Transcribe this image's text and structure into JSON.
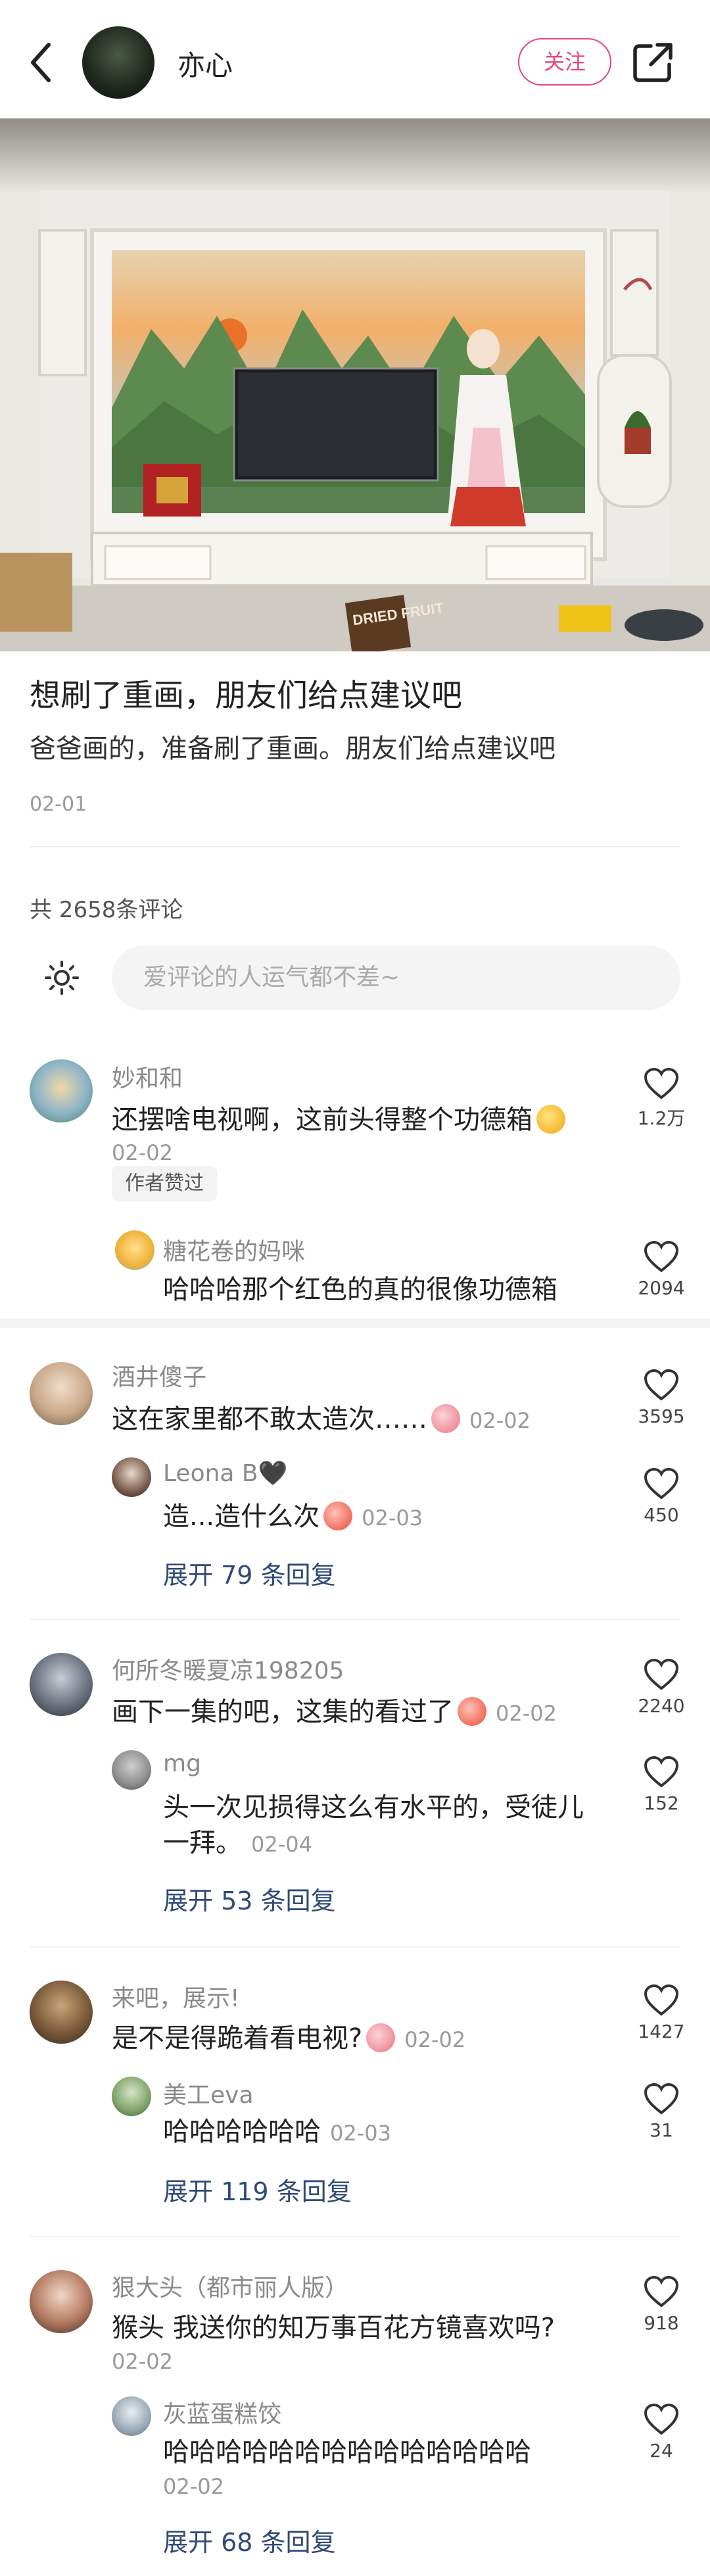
{
  "header": {
    "author_name": "亦心",
    "follow_label": "关注"
  },
  "post": {
    "title": "想刷了重画，朋友们给点建议吧",
    "description": "爸爸画的，准备刷了重画。朋友们给点建议吧",
    "date": "02-01",
    "image_text": "DRIED FRUIT"
  },
  "comments_header": {
    "count_text": "共 2658条评论",
    "input_placeholder": "爱评论的人运气都不差~"
  },
  "comments": [
    {
      "user": "妙和和",
      "text": "还摆啥电视啊，这前头得整个功德箱",
      "date": "02-02",
      "likes": "1.2万",
      "badge": "作者赞过",
      "reply": {
        "user": "糖花卷的妈咪",
        "text": "哈哈哈那个红色的真的很像功德箱",
        "likes": "2094"
      }
    },
    {
      "user": "酒井傻子",
      "text": "这在家里都不敢太造次……",
      "date": "02-02",
      "likes": "3595",
      "reply": {
        "user": "Leona B🖤",
        "text": "造...造什么次",
        "date": "02-03",
        "likes": "450"
      },
      "expand": "展开 79 条回复"
    },
    {
      "user": "何所冬暖夏凉198205",
      "text": "画下一集的吧，这集的看过了",
      "date": "02-02",
      "likes": "2240",
      "reply": {
        "user": "mg",
        "text_line1": "头一次见损得这么有水平的，受徒儿",
        "text_line2": "一拜。",
        "date": "02-04",
        "likes": "152"
      },
      "expand": "展开 53 条回复"
    },
    {
      "user": "来吧，展示!",
      "text": "是不是得跪着看电视?",
      "date": "02-02",
      "likes": "1427",
      "reply": {
        "user": "美工eva",
        "text": "哈哈哈哈哈哈",
        "date": "02-03",
        "likes": "31"
      },
      "expand": "展开 119 条回复"
    },
    {
      "user": "狠大头（都市丽人版）",
      "text": "猴头 我送你的知万事百花方镜喜欢吗?",
      "date": "02-02",
      "likes": "918",
      "reply": {
        "user": "灰蓝蛋糕饺",
        "text": "哈哈哈哈哈哈哈哈哈哈哈哈哈哈",
        "date": "02-02",
        "likes": "24"
      },
      "expand": "展开 68 条回复"
    }
  ]
}
